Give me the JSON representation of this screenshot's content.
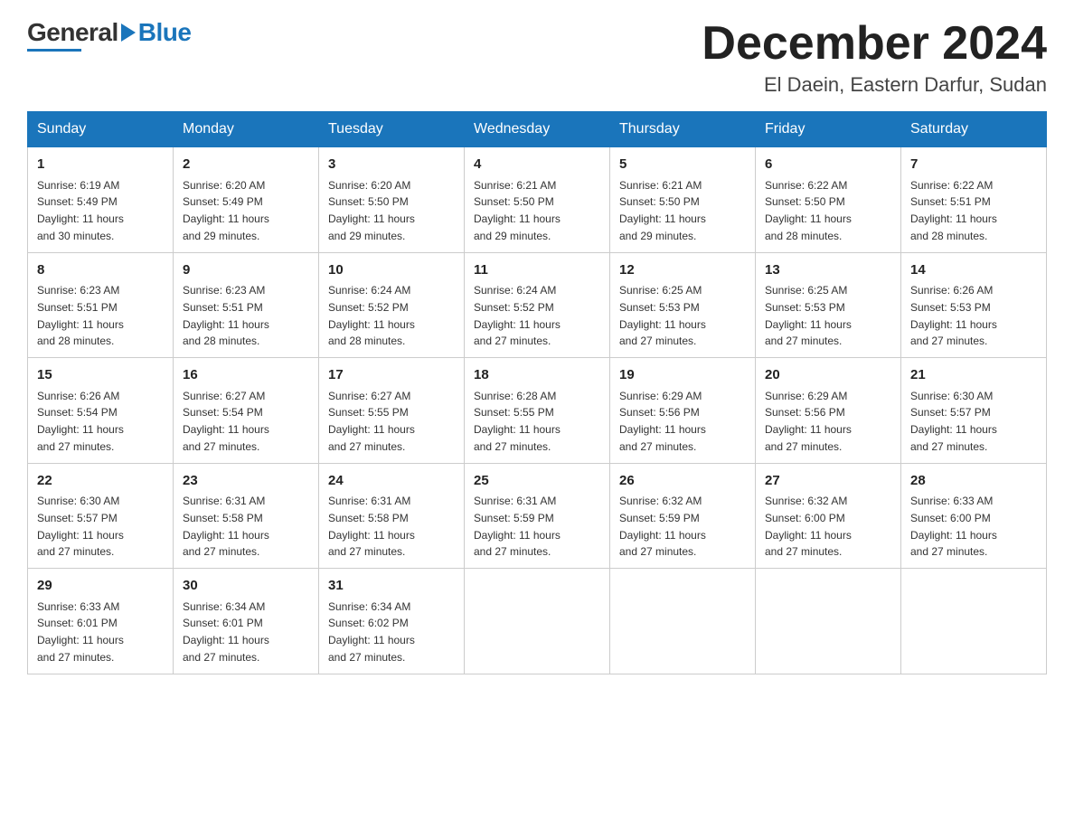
{
  "header": {
    "month_title": "December 2024",
    "location": "El Daein, Eastern Darfur, Sudan",
    "logo_general": "General",
    "logo_blue": "Blue"
  },
  "days_of_week": [
    "Sunday",
    "Monday",
    "Tuesday",
    "Wednesday",
    "Thursday",
    "Friday",
    "Saturday"
  ],
  "weeks": [
    [
      {
        "day": "1",
        "sunrise": "6:19 AM",
        "sunset": "5:49 PM",
        "daylight": "11 hours and 30 minutes."
      },
      {
        "day": "2",
        "sunrise": "6:20 AM",
        "sunset": "5:49 PM",
        "daylight": "11 hours and 29 minutes."
      },
      {
        "day": "3",
        "sunrise": "6:20 AM",
        "sunset": "5:50 PM",
        "daylight": "11 hours and 29 minutes."
      },
      {
        "day": "4",
        "sunrise": "6:21 AM",
        "sunset": "5:50 PM",
        "daylight": "11 hours and 29 minutes."
      },
      {
        "day": "5",
        "sunrise": "6:21 AM",
        "sunset": "5:50 PM",
        "daylight": "11 hours and 29 minutes."
      },
      {
        "day": "6",
        "sunrise": "6:22 AM",
        "sunset": "5:50 PM",
        "daylight": "11 hours and 28 minutes."
      },
      {
        "day": "7",
        "sunrise": "6:22 AM",
        "sunset": "5:51 PM",
        "daylight": "11 hours and 28 minutes."
      }
    ],
    [
      {
        "day": "8",
        "sunrise": "6:23 AM",
        "sunset": "5:51 PM",
        "daylight": "11 hours and 28 minutes."
      },
      {
        "day": "9",
        "sunrise": "6:23 AM",
        "sunset": "5:51 PM",
        "daylight": "11 hours and 28 minutes."
      },
      {
        "day": "10",
        "sunrise": "6:24 AM",
        "sunset": "5:52 PM",
        "daylight": "11 hours and 28 minutes."
      },
      {
        "day": "11",
        "sunrise": "6:24 AM",
        "sunset": "5:52 PM",
        "daylight": "11 hours and 27 minutes."
      },
      {
        "day": "12",
        "sunrise": "6:25 AM",
        "sunset": "5:53 PM",
        "daylight": "11 hours and 27 minutes."
      },
      {
        "day": "13",
        "sunrise": "6:25 AM",
        "sunset": "5:53 PM",
        "daylight": "11 hours and 27 minutes."
      },
      {
        "day": "14",
        "sunrise": "6:26 AM",
        "sunset": "5:53 PM",
        "daylight": "11 hours and 27 minutes."
      }
    ],
    [
      {
        "day": "15",
        "sunrise": "6:26 AM",
        "sunset": "5:54 PM",
        "daylight": "11 hours and 27 minutes."
      },
      {
        "day": "16",
        "sunrise": "6:27 AM",
        "sunset": "5:54 PM",
        "daylight": "11 hours and 27 minutes."
      },
      {
        "day": "17",
        "sunrise": "6:27 AM",
        "sunset": "5:55 PM",
        "daylight": "11 hours and 27 minutes."
      },
      {
        "day": "18",
        "sunrise": "6:28 AM",
        "sunset": "5:55 PM",
        "daylight": "11 hours and 27 minutes."
      },
      {
        "day": "19",
        "sunrise": "6:29 AM",
        "sunset": "5:56 PM",
        "daylight": "11 hours and 27 minutes."
      },
      {
        "day": "20",
        "sunrise": "6:29 AM",
        "sunset": "5:56 PM",
        "daylight": "11 hours and 27 minutes."
      },
      {
        "day": "21",
        "sunrise": "6:30 AM",
        "sunset": "5:57 PM",
        "daylight": "11 hours and 27 minutes."
      }
    ],
    [
      {
        "day": "22",
        "sunrise": "6:30 AM",
        "sunset": "5:57 PM",
        "daylight": "11 hours and 27 minutes."
      },
      {
        "day": "23",
        "sunrise": "6:31 AM",
        "sunset": "5:58 PM",
        "daylight": "11 hours and 27 minutes."
      },
      {
        "day": "24",
        "sunrise": "6:31 AM",
        "sunset": "5:58 PM",
        "daylight": "11 hours and 27 minutes."
      },
      {
        "day": "25",
        "sunrise": "6:31 AM",
        "sunset": "5:59 PM",
        "daylight": "11 hours and 27 minutes."
      },
      {
        "day": "26",
        "sunrise": "6:32 AM",
        "sunset": "5:59 PM",
        "daylight": "11 hours and 27 minutes."
      },
      {
        "day": "27",
        "sunrise": "6:32 AM",
        "sunset": "6:00 PM",
        "daylight": "11 hours and 27 minutes."
      },
      {
        "day": "28",
        "sunrise": "6:33 AM",
        "sunset": "6:00 PM",
        "daylight": "11 hours and 27 minutes."
      }
    ],
    [
      {
        "day": "29",
        "sunrise": "6:33 AM",
        "sunset": "6:01 PM",
        "daylight": "11 hours and 27 minutes."
      },
      {
        "day": "30",
        "sunrise": "6:34 AM",
        "sunset": "6:01 PM",
        "daylight": "11 hours and 27 minutes."
      },
      {
        "day": "31",
        "sunrise": "6:34 AM",
        "sunset": "6:02 PM",
        "daylight": "11 hours and 27 minutes."
      },
      null,
      null,
      null,
      null
    ]
  ],
  "labels": {
    "sunrise": "Sunrise:",
    "sunset": "Sunset:",
    "daylight": "Daylight:"
  }
}
